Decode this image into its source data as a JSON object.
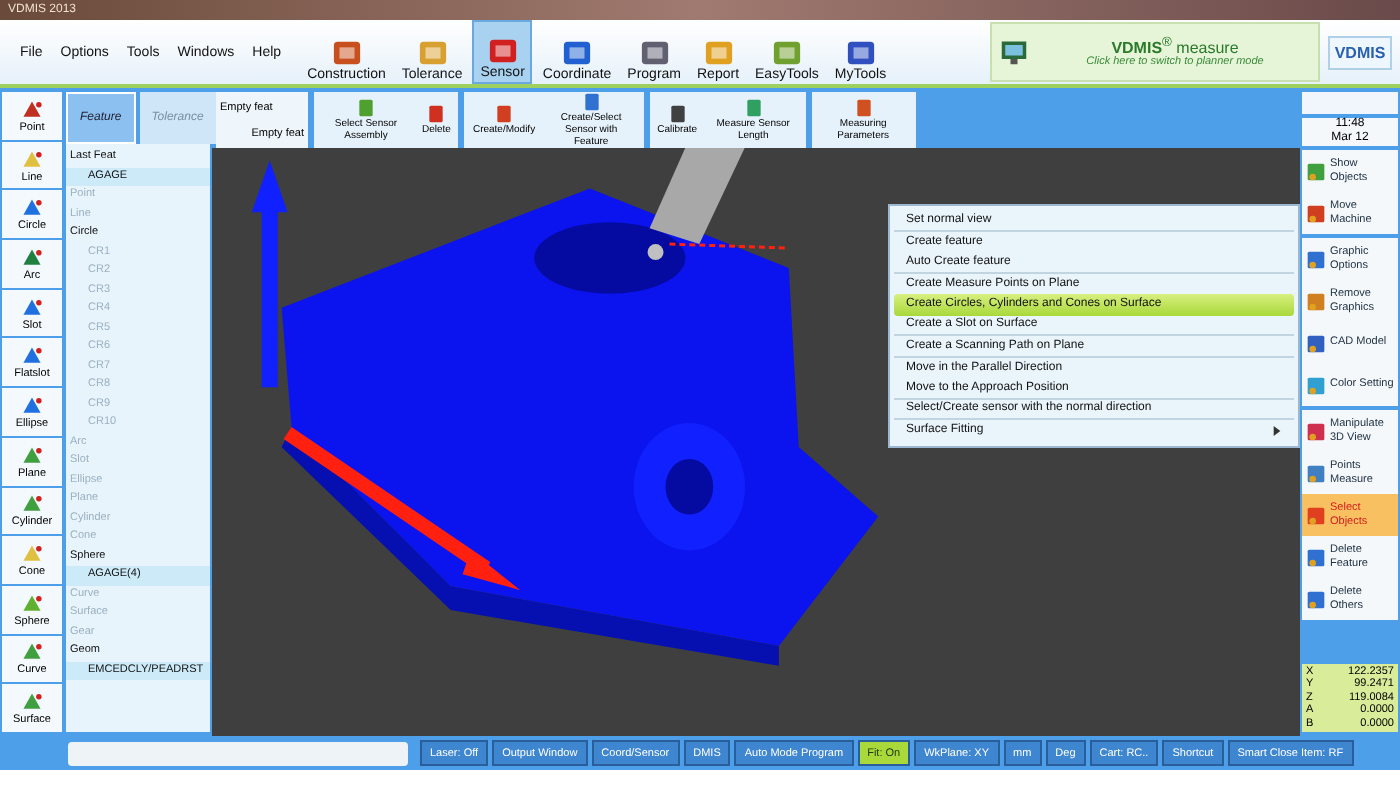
{
  "window": {
    "title": "VDMIS 2013"
  },
  "menu": [
    "File",
    "Options",
    "Tools",
    "Windows",
    "Help"
  ],
  "ribbon_tabs": [
    {
      "label": "Construction",
      "selected": false,
      "color": "#c8501e"
    },
    {
      "label": "Tolerance",
      "selected": false,
      "color": "#d8a030"
    },
    {
      "label": "Sensor",
      "selected": true,
      "color": "#d02020"
    },
    {
      "label": "Coordinate",
      "selected": false,
      "color": "#2060d0"
    },
    {
      "label": "Program",
      "selected": false,
      "color": "#606070"
    },
    {
      "label": "Report",
      "selected": false,
      "color": "#e0a020"
    },
    {
      "label": "EasyTools",
      "selected": false,
      "color": "#70a030"
    },
    {
      "label": "MyTools",
      "selected": false,
      "color": "#3050c0"
    }
  ],
  "mode_panel": {
    "title": "VDMIS",
    "sup": "®",
    "subtitle": "measure",
    "hint": "Click here to switch to planner mode",
    "logo": "VDMIS"
  },
  "feature_buttons": [
    {
      "label": "Point",
      "color": "#c03020"
    },
    {
      "label": "Line",
      "color": "#e0c040"
    },
    {
      "label": "Circle",
      "color": "#2070e0"
    },
    {
      "label": "Arc",
      "color": "#208040"
    },
    {
      "label": "Slot",
      "color": "#2070e0"
    },
    {
      "label": "Flatslot",
      "color": "#2070e0"
    },
    {
      "label": "Ellipse",
      "color": "#2070e0"
    },
    {
      "label": "Plane",
      "color": "#40a040"
    },
    {
      "label": "Cylinder",
      "color": "#40a040"
    },
    {
      "label": "Cone",
      "color": "#e0c040"
    },
    {
      "label": "Sphere",
      "color": "#60b030"
    },
    {
      "label": "Curve",
      "color": "#40a040"
    },
    {
      "label": "Surface",
      "color": "#40a040"
    }
  ],
  "panel_tabs": [
    {
      "label": "Feature",
      "selected": true,
      "disabled": false
    },
    {
      "label": "Tolerance",
      "selected": false,
      "disabled": true
    }
  ],
  "tree": [
    {
      "label": "Last Feat",
      "disabled": false,
      "selected": false,
      "children": [
        {
          "label": "AGAGE",
          "disabled": false,
          "selected": true
        }
      ]
    },
    {
      "label": "Point",
      "disabled": true,
      "selected": false
    },
    {
      "label": "Line",
      "disabled": true,
      "selected": false
    },
    {
      "label": "Circle",
      "disabled": false,
      "selected": false,
      "children": [
        {
          "label": "CR1",
          "disabled": true,
          "selected": false
        },
        {
          "label": "CR2",
          "disabled": true,
          "selected": false
        },
        {
          "label": "CR3",
          "disabled": true,
          "selected": false
        },
        {
          "label": "CR4",
          "disabled": true,
          "selected": false
        },
        {
          "label": "CR5",
          "disabled": true,
          "selected": false
        },
        {
          "label": "CR6",
          "disabled": true,
          "selected": false
        },
        {
          "label": "CR7",
          "disabled": true,
          "selected": false
        },
        {
          "label": "CR8",
          "disabled": true,
          "selected": false
        },
        {
          "label": "CR9",
          "disabled": true,
          "selected": false
        },
        {
          "label": "CR10",
          "disabled": true,
          "selected": false
        }
      ]
    },
    {
      "label": "Arc",
      "disabled": true,
      "selected": false
    },
    {
      "label": "Slot",
      "disabled": true,
      "selected": false
    },
    {
      "label": "Ellipse",
      "disabled": true,
      "selected": false
    },
    {
      "label": "Plane",
      "disabled": true,
      "selected": false
    },
    {
      "label": "Cylinder",
      "disabled": true,
      "selected": false
    },
    {
      "label": "Cone",
      "disabled": true,
      "selected": false
    },
    {
      "label": "Sphere",
      "disabled": false,
      "selected": false,
      "children": [
        {
          "label": "AGAGE(4)",
          "disabled": false,
          "selected": true
        }
      ]
    },
    {
      "label": "Curve",
      "disabled": true,
      "selected": false
    },
    {
      "label": "Surface",
      "disabled": true,
      "selected": false
    },
    {
      "label": "Gear",
      "disabled": true,
      "selected": false
    },
    {
      "label": "Geom",
      "disabled": false,
      "selected": false,
      "children": [
        {
          "label": "EMCEDCLY/PEADRST",
          "disabled": false,
          "selected": true
        }
      ]
    }
  ],
  "empty_feat": [
    "Empty feat",
    "Empty feat"
  ],
  "sensor_groups": [
    [
      {
        "label": "Select Sensor Assembly",
        "color": "#50a030"
      },
      {
        "label": "Delete",
        "color": "#d03020"
      }
    ],
    [
      {
        "label": "Create/Modify",
        "color": "#d04020"
      },
      {
        "label": "Create/Select Sensor with Feature",
        "color": "#3070d0"
      }
    ],
    [
      {
        "label": "Calibrate",
        "color": "#404040"
      },
      {
        "label": "Measure Sensor Length",
        "color": "#30a060"
      }
    ],
    [
      {
        "label": "Measuring Parameters",
        "color": "#d05020"
      }
    ]
  ],
  "context_menu": [
    {
      "label": "Set normal view",
      "selected": false,
      "submenu": false,
      "divider_after": true
    },
    {
      "label": "Create feature",
      "selected": false,
      "submenu": false,
      "divider_after": false
    },
    {
      "label": "Auto Create feature",
      "selected": false,
      "submenu": false,
      "divider_after": true
    },
    {
      "label": "Create Measure Points on Plane",
      "selected": false,
      "submenu": false,
      "divider_after": false
    },
    {
      "label": "Create Circles, Cylinders and Cones on Surface",
      "selected": true,
      "submenu": false,
      "divider_after": false
    },
    {
      "label": "Create a Slot on Surface",
      "selected": false,
      "submenu": false,
      "divider_after": true
    },
    {
      "label": "Create a Scanning Path on Plane",
      "selected": false,
      "submenu": false,
      "divider_after": true
    },
    {
      "label": "Move in the Parallel Direction",
      "selected": false,
      "submenu": false,
      "divider_after": false
    },
    {
      "label": "Move to the Approach Position",
      "selected": false,
      "submenu": false,
      "divider_after": true
    },
    {
      "label": "Select/Create sensor with the normal direction",
      "selected": false,
      "submenu": false,
      "divider_after": true
    },
    {
      "label": "Surface Fitting",
      "selected": false,
      "submenu": true,
      "divider_after": false
    }
  ],
  "right_panel": {
    "clock": [
      "11:48",
      "Mar 12"
    ],
    "groups": [
      [
        {
          "label": "Show Objects",
          "selected": false,
          "color": "#40a040"
        },
        {
          "label": "Move Machine",
          "selected": false,
          "color": "#d04020"
        }
      ],
      [
        {
          "label": "Graphic Options",
          "selected": false,
          "color": "#3070d0"
        },
        {
          "label": "Remove Graphics",
          "selected": false,
          "color": "#d08020"
        },
        {
          "label": "CAD Model",
          "selected": false,
          "color": "#3060c0"
        },
        {
          "label": "Color Setting",
          "selected": false,
          "color": "#30a0d0"
        }
      ],
      [
        {
          "label": "Manipulate 3D View",
          "selected": false,
          "color": "#d03050"
        },
        {
          "label": "Points Measure",
          "selected": false,
          "color": "#4080c0"
        },
        {
          "label": "Select Objects",
          "selected": true,
          "color": "#e04020"
        },
        {
          "label": "Delete Feature",
          "selected": false,
          "color": "#3070d0"
        },
        {
          "label": "Delete Others",
          "selected": false,
          "color": "#3070d0"
        }
      ]
    ],
    "coordinates": [
      {
        "axis": "X",
        "value": "122.2357"
      },
      {
        "axis": "Y",
        "value": "99.2471"
      },
      {
        "axis": "Z",
        "value": "119.0084"
      },
      {
        "axis": "A",
        "value": "0.0000"
      },
      {
        "axis": "B",
        "value": "0.0000"
      }
    ]
  },
  "status_bar": [
    {
      "label": "Laser: Off",
      "selected": false
    },
    {
      "label": "Output Window",
      "selected": false
    },
    {
      "label": "Coord/Sensor",
      "selected": false
    },
    {
      "label": "DMIS",
      "selected": false
    },
    {
      "label": "Auto Mode Program",
      "selected": false
    },
    {
      "label": "Fit: On",
      "selected": true
    },
    {
      "label": "WkPlane: XY",
      "selected": false
    },
    {
      "label": "mm",
      "selected": false
    },
    {
      "label": "Deg",
      "selected": false
    },
    {
      "label": "Cart: RC..",
      "selected": false
    },
    {
      "label": "Shortcut",
      "selected": false
    },
    {
      "label": "Smart Close Item: RF",
      "selected": false
    }
  ]
}
